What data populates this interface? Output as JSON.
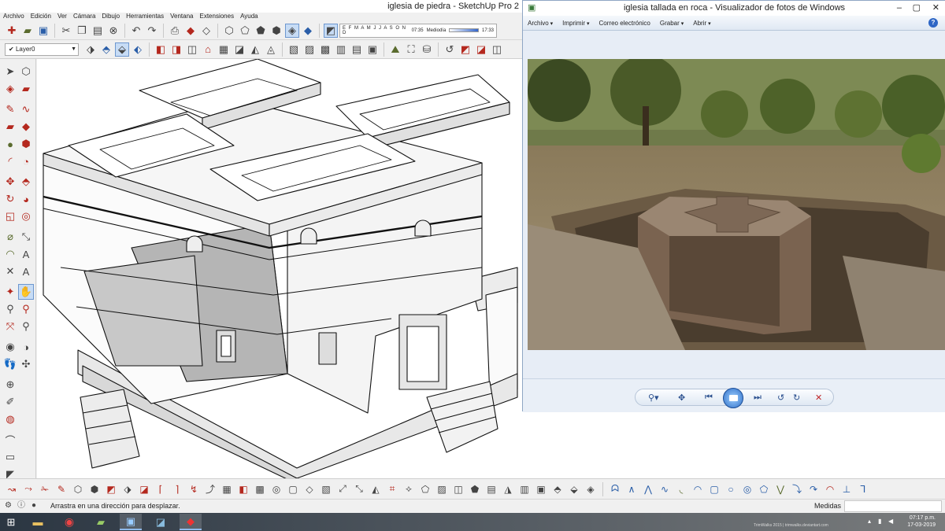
{
  "sketchup": {
    "title": "iglesia de piedra - SketchUp Pro 2",
    "menu": [
      "Archivo",
      "Edición",
      "Ver",
      "Cámara",
      "Dibujo",
      "Herramientas",
      "Ventana",
      "Extensiones",
      "Ayuda"
    ],
    "layer": {
      "value": "Layer0"
    },
    "shadow": {
      "months": "E F M A M J J A S O N D",
      "time_start": "07:35",
      "time_mid": "Mediodía",
      "time_end": "17:33"
    },
    "status_hint": "Arrastra en una dirección para desplazar.",
    "measurements_label": "Medidas",
    "measurements_value": ""
  },
  "viewer": {
    "title": "iglesia tallada en roca - Visualizador de fotos de Windows",
    "menu": [
      "Archivo",
      "Imprimir",
      "Correo electrónico",
      "Grabar",
      "Abrir"
    ],
    "help": "?"
  },
  "taskbar": {
    "time": "07:17 p.m.",
    "date": "17-03-2019",
    "watermark": "TrimWalks 2015 | trimwalks.deviantart.com"
  },
  "colors": {
    "accent": "#2e66c5",
    "sketchup_red": "#b4281e"
  }
}
